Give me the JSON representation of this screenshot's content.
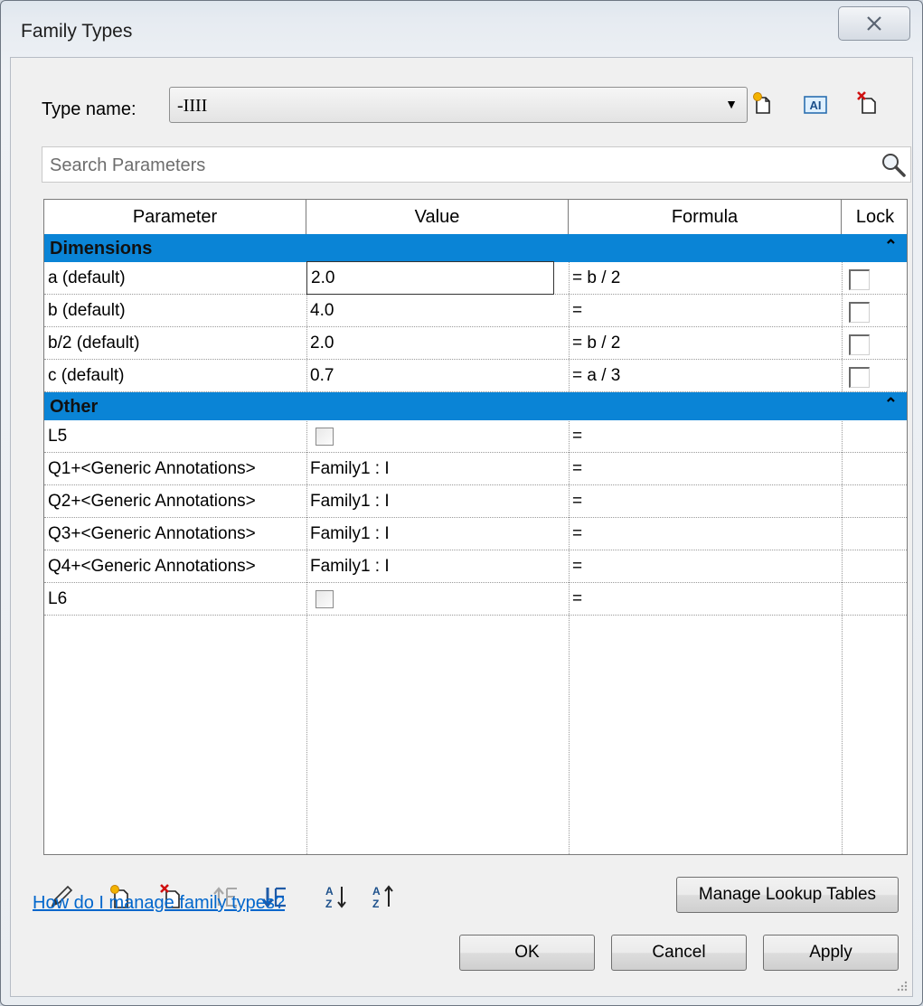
{
  "window": {
    "title": "Family Types",
    "close_glyph": "☒"
  },
  "type_row": {
    "label": "Type name:",
    "selected": "-IIII"
  },
  "search": {
    "placeholder": "Search Parameters"
  },
  "table": {
    "headers": {
      "parameter": "Parameter",
      "value": "Value",
      "formula": "Formula",
      "lock": "Lock"
    },
    "groups": [
      {
        "name": "Dimensions",
        "rows": [
          {
            "parameter": "a (default)",
            "value": "2.0",
            "formula": "= b / 2"
          },
          {
            "parameter": "b (default)",
            "value": "4.0",
            "formula": "="
          },
          {
            "parameter": "b/2 (default)",
            "value": "2.0",
            "formula": "= b / 2"
          },
          {
            "parameter": "c (default)",
            "value": "0.7",
            "formula": "= a / 3"
          }
        ]
      },
      {
        "name": "Other",
        "rows": [
          {
            "parameter": "L5",
            "value": "",
            "formula": "="
          },
          {
            "parameter": "Q1+<Generic Annotations>",
            "value": "Family1 : I",
            "formula": "="
          },
          {
            "parameter": "Q2+<Generic Annotations>",
            "value": "Family1 : I",
            "formula": "="
          },
          {
            "parameter": "Q3+<Generic Annotations>",
            "value": "Family1 : I",
            "formula": "="
          },
          {
            "parameter": "Q4+<Generic Annotations>",
            "value": "Family1 : I",
            "formula": "="
          },
          {
            "parameter": "L6",
            "value": "",
            "formula": "="
          }
        ]
      }
    ]
  },
  "buttons": {
    "manage_lookup": "Manage Lookup Tables",
    "ok": "OK",
    "cancel": "Cancel",
    "apply": "Apply"
  },
  "help_link": "How do I manage family types?",
  "colors": {
    "category_band": "#0a84d6",
    "link": "#0066cc"
  }
}
